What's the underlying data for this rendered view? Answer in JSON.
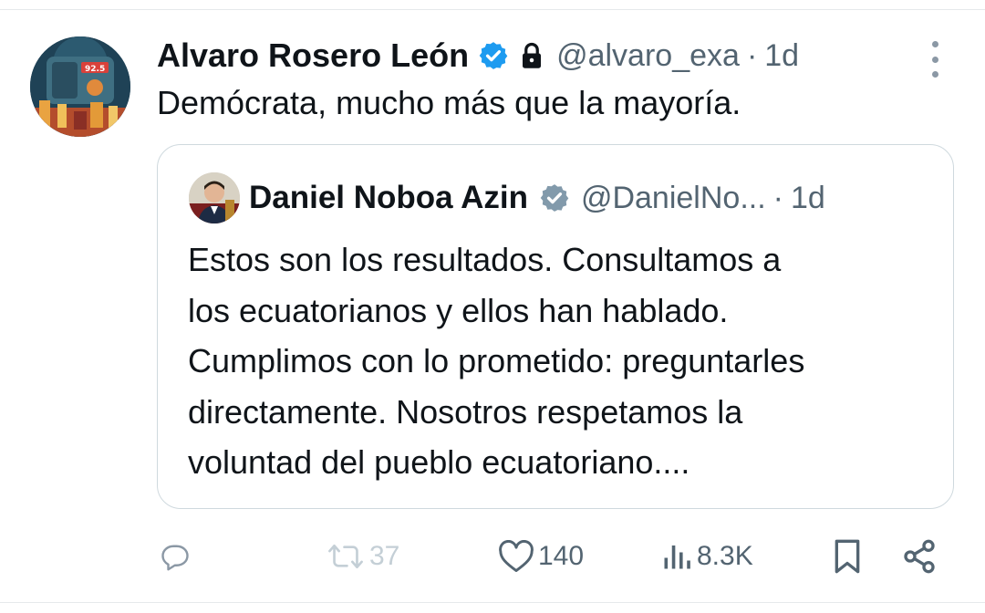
{
  "tweet": {
    "author_name": "Alvaro Rosero León",
    "handle": "@alvaro_exa",
    "separator": "·",
    "time": "1d",
    "text": "Demócrata, mucho más que la mayoría.",
    "avatar_label": "92.5"
  },
  "quote": {
    "author_name": "Daniel Noboa Azin",
    "handle": "@DanielNo...",
    "separator": "·",
    "time": "1d",
    "lines": [
      "Estos son los resultados. Consultamos a",
      "los ecuatorianos y ellos han hablado.",
      "Cumplimos con lo prometido: preguntarles",
      "directamente. Nosotros respetamos la",
      "voluntad del pueblo ecuatoriano...."
    ]
  },
  "actions": {
    "reply_count": "",
    "retweet_count": "37",
    "like_count": "140",
    "views_count": "8.3K"
  },
  "icons": {
    "verified": "verified-badge-icon",
    "lock": "lock-icon",
    "more": "more-vertical-icon",
    "reply": "reply-icon",
    "retweet": "retweet-icon",
    "like": "heart-icon",
    "views": "views-icon",
    "bookmark": "bookmark-icon",
    "share": "share-icon"
  },
  "colors": {
    "verified_blue": "#1d9bf0",
    "verified_gray": "#829aab",
    "secondary_text": "#536471",
    "retweet_disabled": "#c4cfd6"
  }
}
